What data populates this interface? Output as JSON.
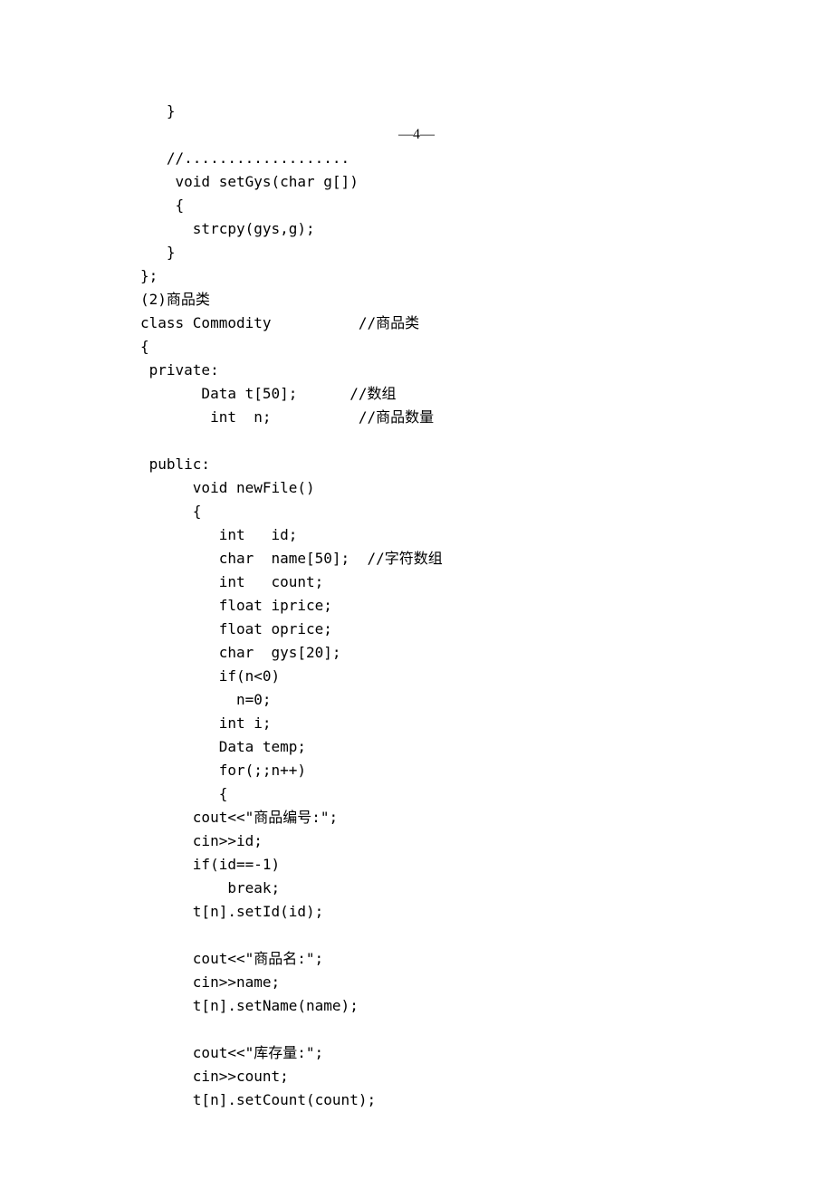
{
  "page_number": "—4—",
  "lines": [
    "   }",
    "__PAGENUM__",
    "   //...................",
    "    void setGys(char g[])",
    "    {",
    "      strcpy(gys,g);",
    "   }",
    "};",
    "(2)商品类",
    "class Commodity          //商品类",
    "{",
    " private:",
    "       Data t[50];      //数组",
    "        int  n;          //商品数量",
    "",
    " public:",
    "      void newFile()",
    "      {",
    "         int   id;",
    "         char  name[50];  //字符数组",
    "         int   count;",
    "         float iprice;",
    "         float oprice;",
    "         char  gys[20];",
    "         if(n<0)",
    "           n=0;",
    "         int i;",
    "         Data temp;",
    "         for(;;n++)",
    "         {",
    "      cout<<\"商品编号:\";",
    "      cin>>id;",
    "      if(id==-1)",
    "          break;",
    "      t[n].setId(id);",
    "",
    "      cout<<\"商品名:\";",
    "      cin>>name;",
    "      t[n].setName(name);",
    "",
    "      cout<<\"库存量:\";",
    "      cin>>count;",
    "      t[n].setCount(count);"
  ]
}
